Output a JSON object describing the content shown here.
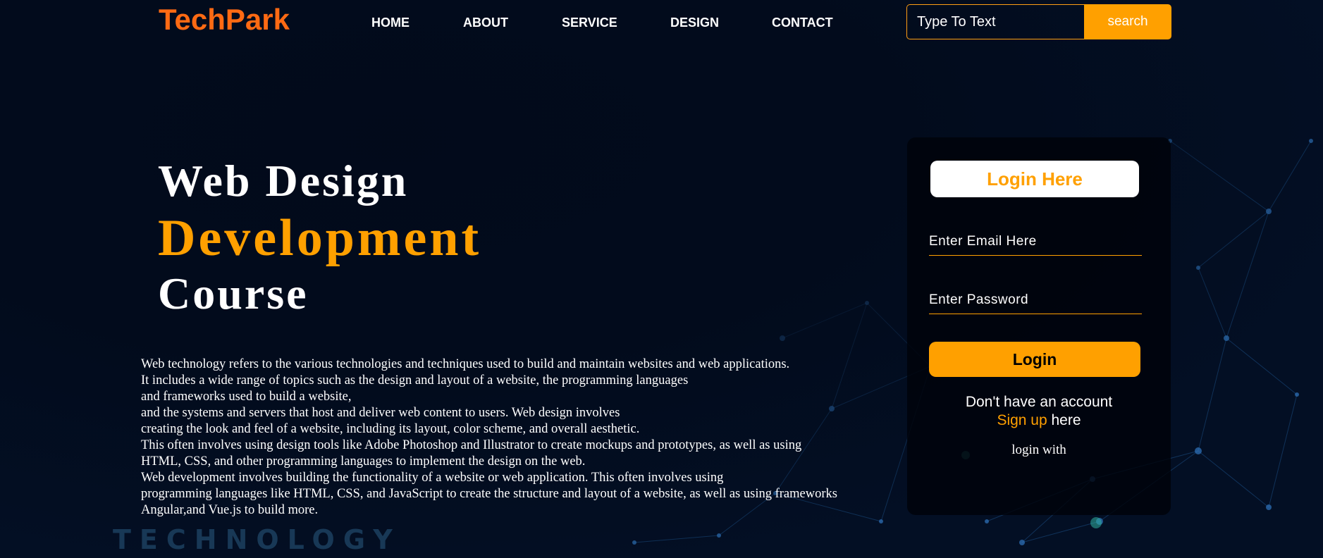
{
  "brand": {
    "logo": "TechPark",
    "logo_color": "#ff6a13"
  },
  "nav": {
    "items": [
      {
        "label": "HOME"
      },
      {
        "label": "ABOUT"
      },
      {
        "label": "SERVICE"
      },
      {
        "label": "DESIGN"
      },
      {
        "label": "CONTACT"
      }
    ]
  },
  "search": {
    "placeholder": "Type To Text",
    "button_label": "search"
  },
  "hero": {
    "line1": "Web Design",
    "line2": "Development",
    "line3": "Course",
    "description": [
      "Web technology refers to the various technologies and techniques used to build and maintain websites and web applications.",
      "It includes a wide range of topics such as the design and layout of a website, the programming languages",
      "and frameworks used to build a website,",
      "and the systems and servers that host and deliver web content to users. Web design involves",
      "creating the look and feel of a website, including its layout, color scheme, and overall aesthetic.",
      "This often involves using design tools like Adobe Photoshop and Illustrator to create mockups and prototypes, as well as using",
      "HTML, CSS, and other programming languages to implement the design on the web.",
      "Web development involves building the functionality of a website or web application. This often involves using",
      "programming languages like HTML, CSS, and JavaScript to create the structure and layout of a website, as well as using frameworks",
      "Angular,and Vue.js to build more."
    ],
    "background_word": "TECHNOLOGY"
  },
  "login": {
    "title": "Login Here",
    "email_placeholder": "Enter Email Here",
    "password_placeholder": "Enter Password",
    "button_label": "Login",
    "no_account_text": "Don't have an account",
    "signup_link": "Sign up",
    "signup_suffix": " here",
    "login_with": "login with"
  },
  "colors": {
    "accent": "#ffa000",
    "background": "#030f24",
    "text": "#ffffff"
  }
}
